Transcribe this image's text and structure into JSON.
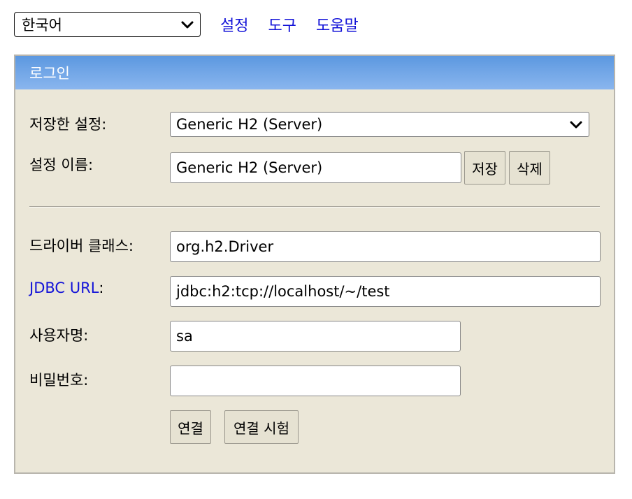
{
  "topbar": {
    "language_selected": "한국어",
    "links": [
      "설정",
      "도구",
      "도움말"
    ]
  },
  "panel": {
    "title": "로그인",
    "saved_settings_label": "저장한 설정:",
    "saved_settings_value": "Generic H2 (Server)",
    "setting_name_label": "설정 이름:",
    "setting_name_value": "Generic H2 (Server)",
    "save_button": "저장",
    "delete_button": "삭제",
    "driver_class_label": "드라이버 클래스:",
    "driver_class_value": "org.h2.Driver",
    "jdbc_url_link": "JDBC URL",
    "jdbc_url_colon": ":",
    "jdbc_url_value": "jdbc:h2:tcp://localhost/~/test",
    "username_label": "사용자명:",
    "username_value": "sa",
    "password_label": "비밀번호:",
    "password_value": "",
    "connect_button": "연결",
    "test_connection_button": "연결 시험"
  },
  "colors": {
    "link": "#1414d8",
    "panel_background": "#ebe7d8",
    "header_gradient_top": "#5c98e0",
    "header_gradient_bottom": "#8ab6ee"
  },
  "icons": {
    "dropdown": "chevron-down-icon"
  }
}
